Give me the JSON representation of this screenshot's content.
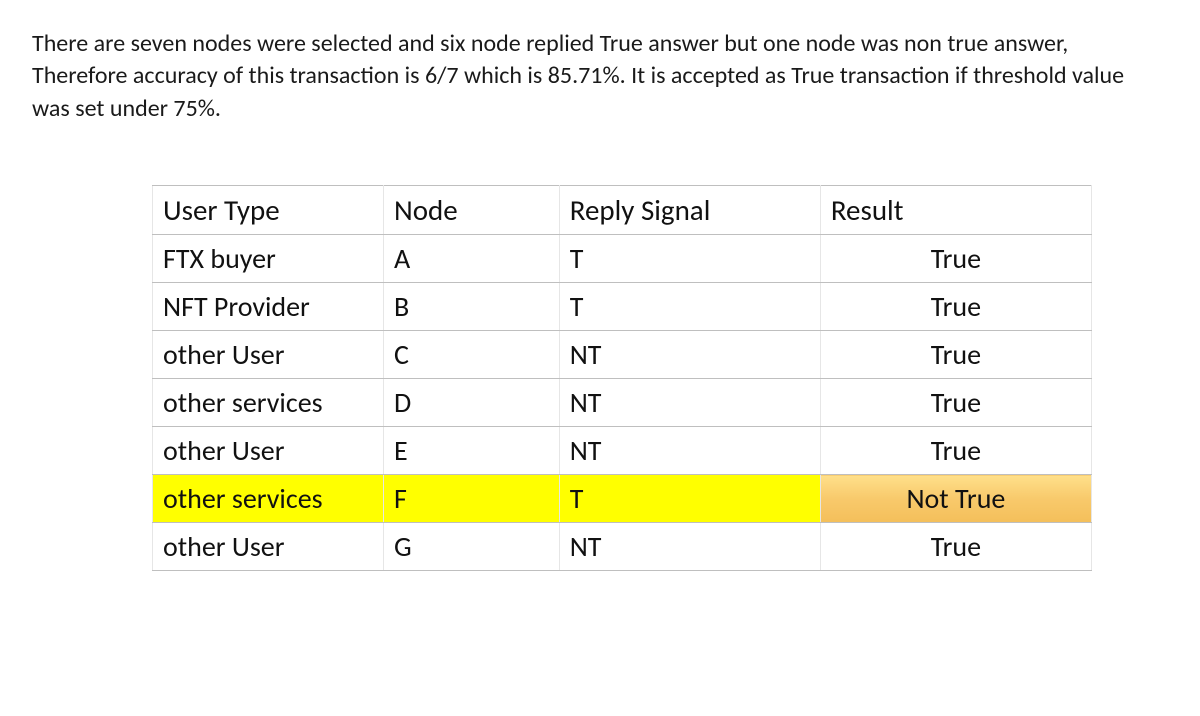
{
  "description": "There are seven nodes were selected and six node replied True answer but one node was non true answer, Therefore accuracy of this transaction is 6/7 which is 85.71%. It is accepted as True transaction if threshold value was set under 75%.",
  "table": {
    "headers": {
      "user_type": "User Type",
      "node": "Node",
      "reply_signal": "Reply Signal",
      "result": "Result"
    },
    "rows": [
      {
        "user_type": "FTX buyer",
        "node": "A",
        "reply_signal": "T",
        "result": "True",
        "highlight": false
      },
      {
        "user_type": "NFT Provider",
        "node": "B",
        "reply_signal": "T",
        "result": "True",
        "highlight": false
      },
      {
        "user_type": "other User",
        "node": "C",
        "reply_signal": "NT",
        "result": "True",
        "highlight": false
      },
      {
        "user_type": "other services",
        "node": "D",
        "reply_signal": "NT",
        "result": "True",
        "highlight": false
      },
      {
        "user_type": "other User",
        "node": "E",
        "reply_signal": "NT",
        "result": "True",
        "highlight": false
      },
      {
        "user_type": "other services",
        "node": "F",
        "reply_signal": "T",
        "result": "Not True",
        "highlight": true
      },
      {
        "user_type": "other User",
        "node": "G",
        "reply_signal": "NT",
        "result": "True",
        "highlight": false
      }
    ]
  }
}
